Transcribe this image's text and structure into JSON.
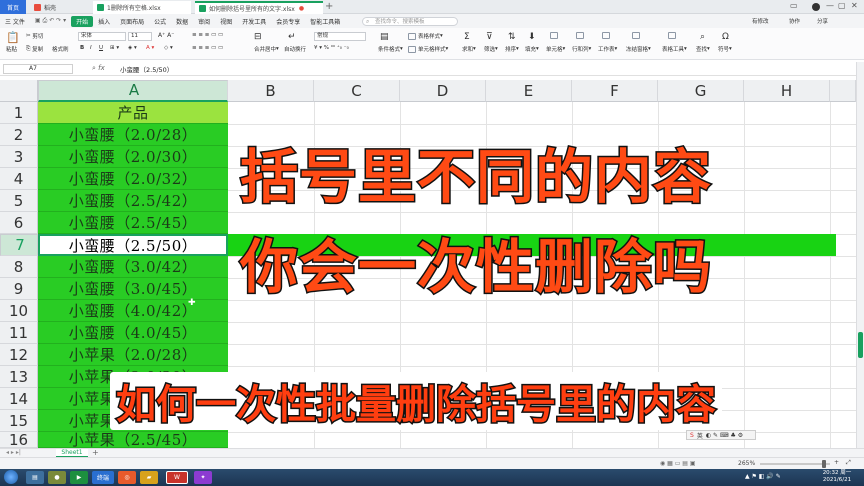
{
  "titlebar": {
    "home_tab": "首页",
    "tabs": [
      "稻壳",
      "1删除所有空格.xlsx",
      "如何删除括号里所有的文字.xlsx"
    ]
  },
  "menubar": {
    "file": "三 文件",
    "items": [
      "开始",
      "插入",
      "页面布局",
      "公式",
      "数据",
      "审阅",
      "视图",
      "开发工具",
      "会员专享",
      "智能工具箱"
    ],
    "active": "开始",
    "search_placeholder": "查找命令、搜索模板",
    "right": [
      "有修改",
      "协作",
      "分享"
    ]
  },
  "ribbon": {
    "paste": "粘贴",
    "cut": "剪切",
    "copy": "复制",
    "format_painter": "格式刷",
    "font": "宋体",
    "font_size": "11",
    "bold": "B",
    "italic": "I",
    "underline": "U",
    "merge": "合并居中",
    "wrap": "自动换行",
    "number_format": "常规",
    "cond_format": "条件格式",
    "table_style": "表格样式",
    "cell_style": "单元格样式",
    "sum": "求和",
    "filter": "筛选",
    "sort": "排序",
    "fill": "填充",
    "cell": "单元格",
    "rowcol": "行和列",
    "worksheet": "工作表",
    "freeze": "冻结窗格",
    "table_tools": "表格工具",
    "find": "查找",
    "symbol": "符号"
  },
  "formulabar": {
    "name_box": "A7",
    "fx": "fx",
    "formula": "小蛮腰（2.5/50）"
  },
  "columns": [
    "A",
    "B",
    "C",
    "D",
    "E",
    "F",
    "G",
    "H"
  ],
  "selected_column": "A",
  "rows": [
    "1",
    "2",
    "3",
    "4",
    "5",
    "6",
    "7",
    "8",
    "9",
    "10",
    "11",
    "12",
    "13",
    "14",
    "15",
    "16"
  ],
  "selected_row": "7",
  "cells_A": [
    "产品",
    "小蛮腰（2.0/28）",
    "小蛮腰（2.0/30）",
    "小蛮腰（2.0/32）",
    "小蛮腰（2.5/42）",
    "小蛮腰（2.5/45）",
    "小蛮腰（2.5/50）",
    "小蛮腰（3.0/42）",
    "小蛮腰（3.0/45）",
    "小蛮腰（4.0/42）",
    "小蛮腰（4.0/45）",
    "小苹果（2.0/28）",
    "小苹果（2.0/30）",
    "小苹果（2.0/32）",
    "小苹果（2.5/42）",
    "小苹果（2.5/45）"
  ],
  "overlay": {
    "title_line1": "括号里不同的内容",
    "title_line2": "你会一次性删除吗",
    "subtitle": "如何一次性批量删除括号里的内容"
  },
  "ime": "英",
  "sheet_tab": "Sheet1",
  "statusbar": {
    "zoom": "265%"
  },
  "taskbar": {
    "clock_time": "20:32 周一",
    "clock_date": "2021/6/21",
    "app_label": "终端"
  },
  "colors": {
    "accent": "#19a15f",
    "cell_green": "#29cc24",
    "header_green": "#9be33f",
    "title_orange": "#ff4a14"
  }
}
